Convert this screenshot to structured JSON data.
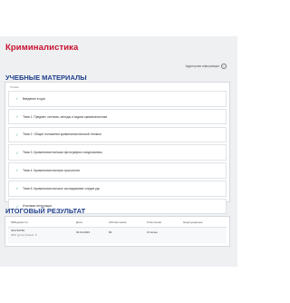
{
  "course": {
    "title": "Криминалистика"
  },
  "top_link": {
    "label": "Аудиторная информация"
  },
  "materials": {
    "title": "УЧЕБНЫЕ МАТЕРИАЛЫ",
    "tag": "Топики",
    "items": [
      {
        "label": "Введение в курс"
      },
      {
        "label": "Тема 1. Предмет, система, методы и задачи криминалистики"
      },
      {
        "label": "Тема 2. Общие положения криминалистической техники"
      },
      {
        "label": "Тема 3. Криминалистическая фотография и видеозапись"
      },
      {
        "label": "Тема 4. Криминалистическая трасология"
      },
      {
        "label": "Тема 5. Криминалистическое исследование следов рук"
      },
      {
        "label": "Итоговая аттестация"
      }
    ]
  },
  "results": {
    "title": "ИТОГОВЫЙ РЕЗУЛЬТАТ",
    "headers": [
      "№Ведомости",
      "Дата",
      "100-балльная",
      "5-балльная",
      "Недопущенные"
    ],
    "row": {
      "id": "321719790",
      "subtitle": "ЗОЧ (устн) Очно/з. б",
      "date": "30.04.2023",
      "score100": "83",
      "score5": "Отлично",
      "excluded": ""
    }
  }
}
